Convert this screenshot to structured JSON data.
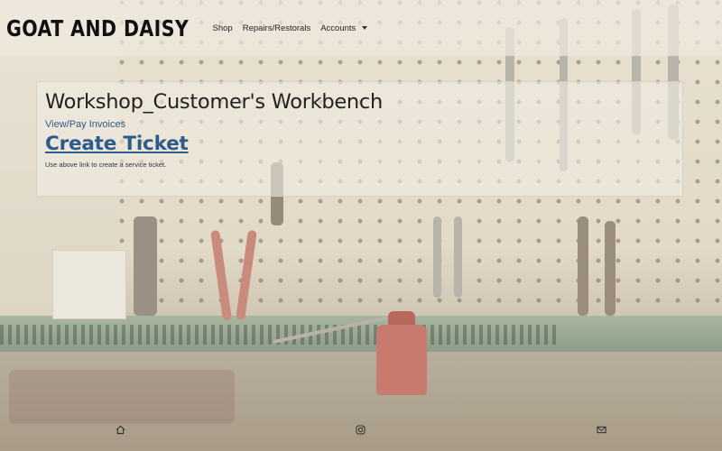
{
  "brand": {
    "name": "GOAT AND DAISY"
  },
  "nav": {
    "items": [
      {
        "label": "Shop"
      },
      {
        "label": "Repairs/Restorals"
      },
      {
        "label": "Accounts"
      }
    ]
  },
  "main": {
    "title": "Workshop_Customer's Workbench",
    "invoices_link": "View/Pay Invoices",
    "create_ticket_link": "Create Ticket",
    "hint": "Use above link to create a service ticket."
  },
  "footer": {
    "icons": [
      "home-icon",
      "instagram-icon",
      "envelope-icon"
    ]
  },
  "colors": {
    "link": "#2d5b8a",
    "text": "#222222"
  }
}
